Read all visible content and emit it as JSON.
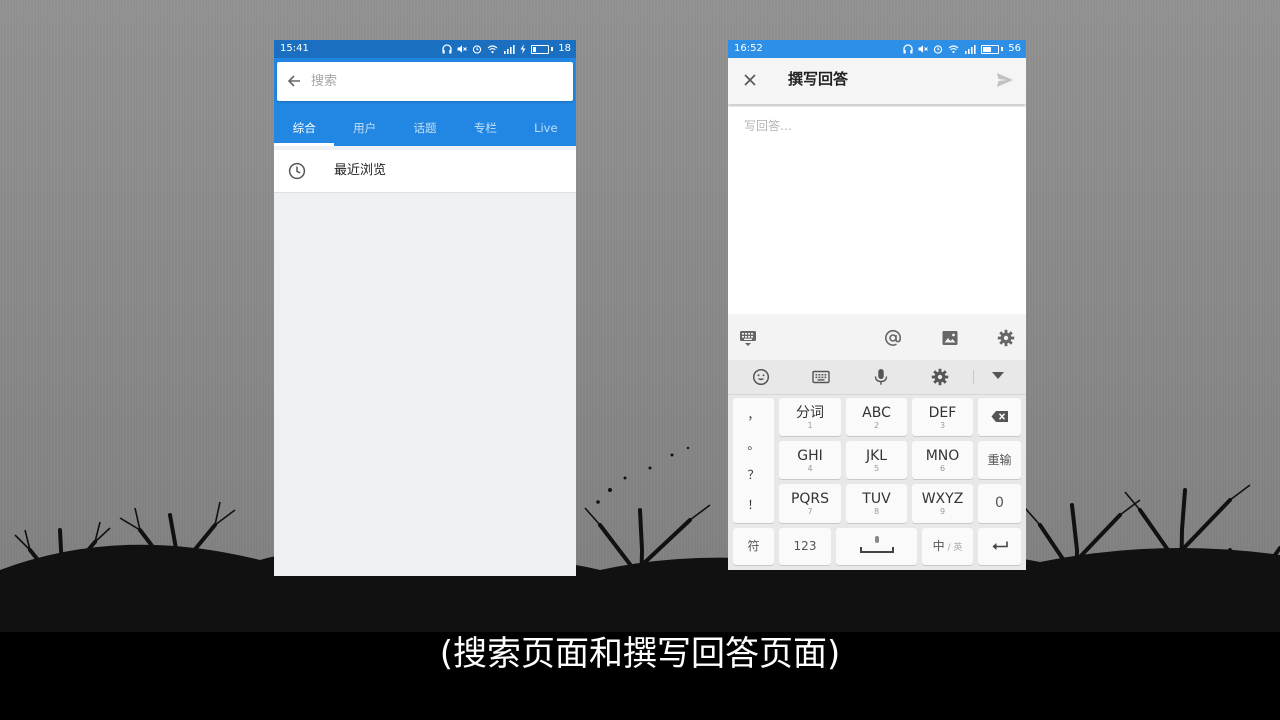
{
  "caption": "(搜索页面和撰写回答页面)",
  "search_screen": {
    "status_time": "15:41",
    "battery_level": "18",
    "search_placeholder": "搜索",
    "tabs": [
      {
        "label": "综合",
        "active": true
      },
      {
        "label": "用户",
        "active": false
      },
      {
        "label": "话题",
        "active": false
      },
      {
        "label": "专栏",
        "active": false
      },
      {
        "label": "Live",
        "active": false
      }
    ],
    "recent_label": "最近浏览",
    "colors": {
      "header": "#2287e3",
      "statusbar": "#1a6fc1",
      "content_bg": "#eef1f3"
    }
  },
  "answer_screen": {
    "status_time": "16:52",
    "battery_level": "56",
    "title": "撰写回答",
    "body_placeholder": "写回答…",
    "editor_icons": [
      "keyboard-icon",
      "at-icon",
      "image-icon",
      "gear-icon"
    ],
    "keyboard": {
      "toolbar_icons": [
        "emoji-icon",
        "keyboard-icon",
        "mic-icon",
        "gear-icon",
        "collapse-icon"
      ],
      "punctuation": [
        "，",
        "。",
        "？",
        "！"
      ],
      "row1": [
        {
          "main": "分词",
          "sub": "1"
        },
        {
          "main": "ABC",
          "sub": "2"
        },
        {
          "main": "DEF",
          "sub": "3"
        }
      ],
      "row2": [
        {
          "main": "GHI",
          "sub": "4"
        },
        {
          "main": "JKL",
          "sub": "5"
        },
        {
          "main": "MNO",
          "sub": "6"
        }
      ],
      "row3": [
        {
          "main": "PQRS",
          "sub": "7"
        },
        {
          "main": "TUV",
          "sub": "8"
        },
        {
          "main": "WXYZ",
          "sub": "9"
        }
      ],
      "reenter": "重输",
      "zero": "0",
      "symbols": "符",
      "numbers": "123",
      "lang_main": "中",
      "lang_sep": "/",
      "lang_alt": "英"
    },
    "colors": {
      "statusbar": "#2e8fe6",
      "toolbar": "#f5f5f5",
      "keyboard_bg": "#e8e8e8"
    }
  }
}
